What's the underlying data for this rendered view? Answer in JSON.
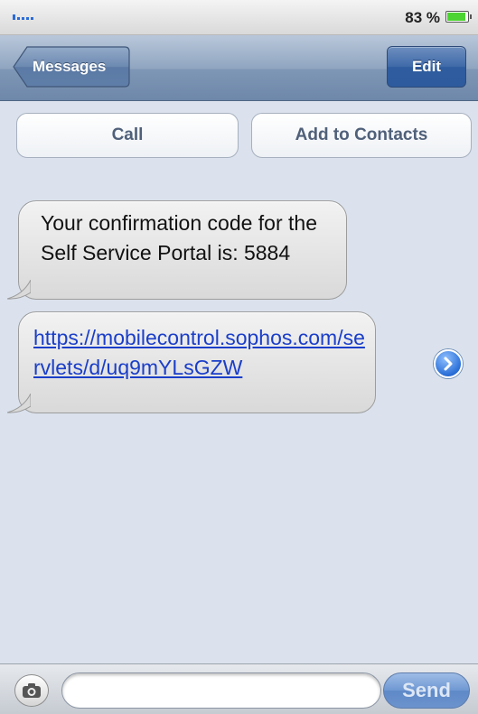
{
  "status_bar": {
    "battery_percent_text": "83 %",
    "battery_level": 0.83,
    "signal_icon": "signal-bars-icon",
    "battery_icon": "battery-icon"
  },
  "nav": {
    "back_label": "Messages",
    "edit_label": "Edit"
  },
  "actions": {
    "call_label": "Call",
    "add_contact_label": "Add to Contacts"
  },
  "messages": [
    {
      "text": "Your confirmation code for the Self Service Portal is: 5884"
    },
    {
      "link_text": "https://mobilecontrol.sophos.com/servlets/d/uq9mYLsGZW"
    }
  ],
  "compose": {
    "camera_icon": "camera-icon",
    "input_value": "",
    "send_label": "Send"
  },
  "colors": {
    "nav_blue": "#6e88aa",
    "link": "#1a3ec9",
    "edit_blue": "#2e5c9f"
  }
}
